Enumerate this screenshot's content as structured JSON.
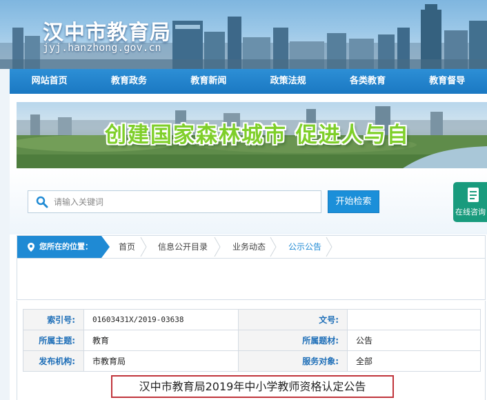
{
  "header": {
    "site_title": "汉中市教育局",
    "site_domain": "jyj.hanzhong.gov.cn"
  },
  "nav": {
    "items": [
      {
        "label": "网站首页"
      },
      {
        "label": "教育政务"
      },
      {
        "label": "教育新闻"
      },
      {
        "label": "政策法规"
      },
      {
        "label": "各类教育"
      },
      {
        "label": "教育督导"
      }
    ]
  },
  "banner": {
    "slogan": "创建国家森林城市  促进人与自"
  },
  "search": {
    "placeholder": "请输入关键词",
    "button_label": "开始检索",
    "icon": "search-icon"
  },
  "consult": {
    "label": "在线咨询",
    "icon": "document-icon"
  },
  "breadcrumb": {
    "here_label": "您所在的位置：",
    "items": [
      {
        "label": "首页"
      },
      {
        "label": "信息公开目录"
      },
      {
        "label": "业务动态"
      },
      {
        "label": "公示公告"
      }
    ]
  },
  "meta": {
    "index_label": "索引号:",
    "index_value": "01603431X/2019-03638",
    "docno_label": "文号:",
    "docno_value": "",
    "topic_label": "所属主题:",
    "topic_value": "教育",
    "genre_label": "所属题材:",
    "genre_value": "公告",
    "issuer_label": "发布机构:",
    "issuer_value": "市教育局",
    "audience_label": "服务对象:",
    "audience_value": "全部"
  },
  "document": {
    "title": "汉中市教育局2019年中小学教师资格认定公告"
  },
  "colors": {
    "nav_bg": "#1a78c2",
    "accent_blue": "#1f8ad4",
    "consult_green": "#199b7d",
    "title_border": "#c0333a"
  }
}
